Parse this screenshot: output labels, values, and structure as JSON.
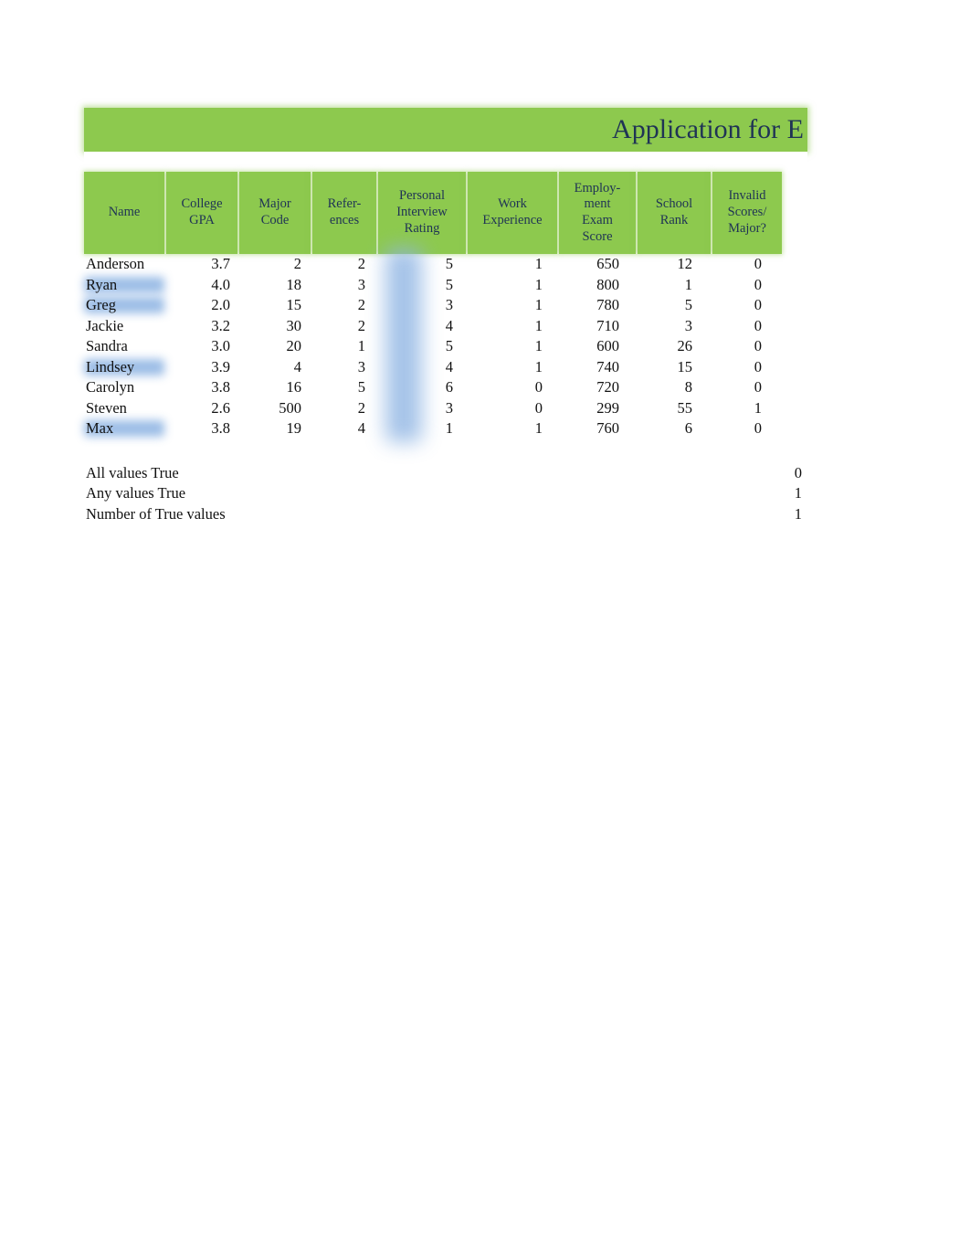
{
  "document": {
    "title": "Application for E"
  },
  "table": {
    "columns": [
      {
        "label": "Name",
        "key": "name",
        "align": "left"
      },
      {
        "label": "College\nGPA",
        "key": "college_gpa",
        "align": "right"
      },
      {
        "label": "Major\nCode",
        "key": "major_code",
        "align": "right"
      },
      {
        "label": "Refer-\nences",
        "key": "references",
        "align": "right"
      },
      {
        "label": "Personal\nInterview\nRating",
        "key": "interview_rating",
        "align": "right"
      },
      {
        "label": "Work\nExperience",
        "key": "work_experience",
        "align": "right"
      },
      {
        "label": "Employ-\nment\nExam\nScore",
        "key": "exam_score",
        "align": "right"
      },
      {
        "label": "School\nRank",
        "key": "school_rank",
        "align": "right"
      },
      {
        "label": "Invalid\nScores/\nMajor?",
        "key": "invalid",
        "align": "right"
      }
    ],
    "rows": [
      {
        "name": "Anderson",
        "college_gpa": "3.7",
        "major_code": "2",
        "references": "2",
        "interview_rating": "5",
        "work_experience": "1",
        "exam_score": "650",
        "school_rank": "12",
        "invalid": "0",
        "highlighted": false
      },
      {
        "name": "Ryan",
        "college_gpa": "4.0",
        "major_code": "18",
        "references": "3",
        "interview_rating": "5",
        "work_experience": "1",
        "exam_score": "800",
        "school_rank": "1",
        "invalid": "0",
        "highlighted": true
      },
      {
        "name": "Greg",
        "college_gpa": "2.0",
        "major_code": "15",
        "references": "2",
        "interview_rating": "3",
        "work_experience": "1",
        "exam_score": "780",
        "school_rank": "5",
        "invalid": "0",
        "highlighted": true
      },
      {
        "name": "Jackie",
        "college_gpa": "3.2",
        "major_code": "30",
        "references": "2",
        "interview_rating": "4",
        "work_experience": "1",
        "exam_score": "710",
        "school_rank": "3",
        "invalid": "0",
        "highlighted": false
      },
      {
        "name": "Sandra",
        "college_gpa": "3.0",
        "major_code": "20",
        "references": "1",
        "interview_rating": "5",
        "work_experience": "1",
        "exam_score": "600",
        "school_rank": "26",
        "invalid": "0",
        "highlighted": false
      },
      {
        "name": "Lindsey",
        "college_gpa": "3.9",
        "major_code": "4",
        "references": "3",
        "interview_rating": "4",
        "work_experience": "1",
        "exam_score": "740",
        "school_rank": "15",
        "invalid": "0",
        "highlighted": true
      },
      {
        "name": "Carolyn",
        "college_gpa": "3.8",
        "major_code": "16",
        "references": "5",
        "interview_rating": "6",
        "work_experience": "0",
        "exam_score": "720",
        "school_rank": "8",
        "invalid": "0",
        "highlighted": false
      },
      {
        "name": "Steven",
        "college_gpa": "2.6",
        "major_code": "500",
        "references": "2",
        "interview_rating": "3",
        "work_experience": "0",
        "exam_score": "299",
        "school_rank": "55",
        "invalid": "1",
        "highlighted": false
      },
      {
        "name": "Max",
        "college_gpa": "3.8",
        "major_code": "19",
        "references": "4",
        "interview_rating": "1",
        "work_experience": "1",
        "exam_score": "760",
        "school_rank": "6",
        "invalid": "0",
        "highlighted": true
      }
    ]
  },
  "summary": [
    {
      "label": "All values True",
      "value": "0"
    },
    {
      "label": "Any values True",
      "value": "1"
    },
    {
      "label": "Number of True values",
      "value": "1"
    }
  ],
  "colors": {
    "header_green": "#8DC94E",
    "header_text": "#1F3355",
    "body_text": "#111111",
    "selection_blue": "#8EB4E3",
    "background": "#FFFFFF"
  }
}
